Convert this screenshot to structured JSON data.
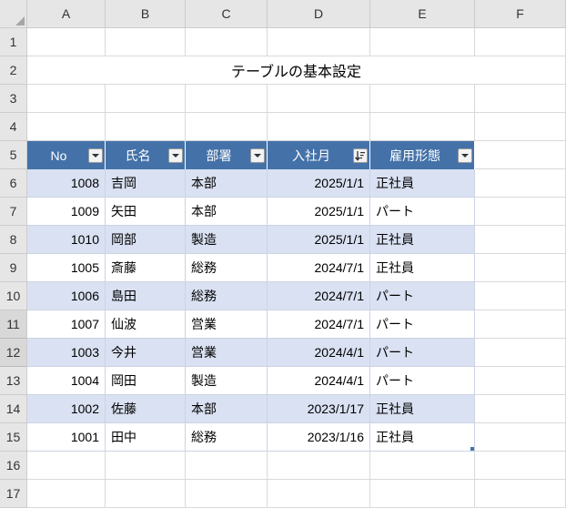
{
  "columns": [
    "A",
    "B",
    "C",
    "D",
    "E",
    "F"
  ],
  "row_headers": [
    "1",
    "2",
    "3",
    "4",
    "5",
    "6",
    "7",
    "8",
    "9",
    "10",
    "11",
    "12",
    "13",
    "14",
    "15",
    "16",
    "17"
  ],
  "title": "テーブルの基本設定",
  "table": {
    "headers": [
      {
        "label": "No",
        "sort": "filter"
      },
      {
        "label": "氏名",
        "sort": "filter"
      },
      {
        "label": "部署",
        "sort": "filter"
      },
      {
        "label": "入社月",
        "sort": "desc"
      },
      {
        "label": "雇用形態",
        "sort": "filter"
      }
    ],
    "rows": [
      {
        "no": "1008",
        "name": "吉岡",
        "dept": "本部",
        "date": "2025/1/1",
        "type": "正社員"
      },
      {
        "no": "1009",
        "name": "矢田",
        "dept": "本部",
        "date": "2025/1/1",
        "type": "パート"
      },
      {
        "no": "1010",
        "name": "岡部",
        "dept": "製造",
        "date": "2025/1/1",
        "type": "正社員"
      },
      {
        "no": "1005",
        "name": "斎藤",
        "dept": "総務",
        "date": "2024/7/1",
        "type": "正社員"
      },
      {
        "no": "1006",
        "name": "島田",
        "dept": "総務",
        "date": "2024/7/1",
        "type": "パート"
      },
      {
        "no": "1007",
        "name": "仙波",
        "dept": "営業",
        "date": "2024/7/1",
        "type": "パート"
      },
      {
        "no": "1003",
        "name": "今井",
        "dept": "営業",
        "date": "2024/4/1",
        "type": "パート"
      },
      {
        "no": "1004",
        "name": "岡田",
        "dept": "製造",
        "date": "2024/4/1",
        "type": "パート"
      },
      {
        "no": "1002",
        "name": "佐藤",
        "dept": "本部",
        "date": "2023/1/17",
        "type": "正社員"
      },
      {
        "no": "1001",
        "name": "田中",
        "dept": "総務",
        "date": "2023/1/16",
        "type": "正社員"
      }
    ]
  }
}
